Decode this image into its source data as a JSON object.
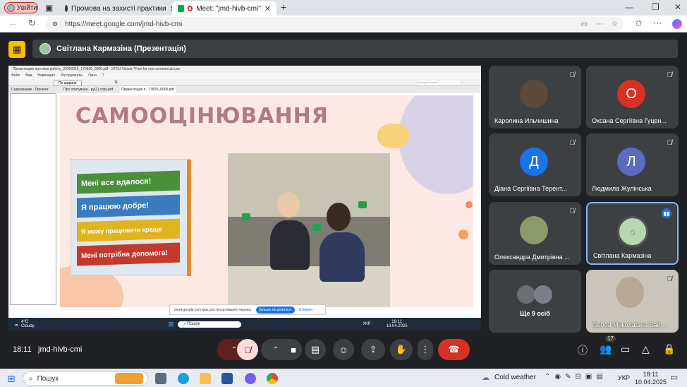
{
  "browser": {
    "profile_label": "Увійти",
    "tabs": [
      {
        "title": "Промова на захисті практики"
      },
      {
        "title": "Meet: \"jmd-hivb-cmi\""
      }
    ],
    "new_tab": "+",
    "url": "https://meet.google.com/jmd-hivb-cmi"
  },
  "meet": {
    "presenting_label": "Світлана Кармазіна (Презентація)",
    "shared_window": {
      "title": "Презентация про мою роботу_20250316_173826_0000.pdf - STDU Viewer *Free for non-commercial use",
      "menu": [
        "Файл",
        "Вид",
        "Навигация",
        "Инструменты",
        "Окно",
        "?"
      ],
      "zoom": "По ширине",
      "page": "11",
      "search_placeholder": "Быстрый поиск",
      "sidebar_tab": "Содержание - Презент",
      "doc_tabs": [
        "Про опитуванн...ру(1) copy.pdf",
        "Презентация п...73826_0000.pdf"
      ],
      "slide_title": "САМООЦІНЮВАННЯ",
      "lego_rows": [
        {
          "text": "Мені все вдалося!",
          "color": "#4a8f3a"
        },
        {
          "text": "Я працюю добре!",
          "color": "#3a7cc0"
        },
        {
          "text": "Я можу працювати краще",
          "color": "#e0b420"
        },
        {
          "text": "Мені потрібна допомога!",
          "color": "#c23a2c"
        }
      ],
      "notification": {
        "text": "meet.google.com має доступ до вашого екрана.",
        "stop_button": "Більше не ділитися",
        "hide_link": "Сховати"
      },
      "taskbar": {
        "weather_temp": "4°C",
        "weather_desc": "Cloudy",
        "search_label": "Пошук",
        "lang": "УКР",
        "time": "18:11",
        "date": "10.04.2025"
      }
    },
    "participants": [
      {
        "name": "Каролина Ильчишина",
        "initial": "",
        "avatar_color": "#5c4a3c",
        "muted": true,
        "speaking": false
      },
      {
        "name": "Оксана Сергіївна Гуцен...",
        "initial": "О",
        "avatar_color": "#d93025",
        "muted": true,
        "speaking": false
      },
      {
        "name": "Діана Сергіївна Терент...",
        "initial": "Д",
        "avatar_color": "#1a73e8",
        "muted": true,
        "speaking": false
      },
      {
        "name": "Людмила Жулінська",
        "initial": "Л",
        "avatar_color": "#5c6bc0",
        "muted": true,
        "speaking": false
      },
      {
        "name": "Олександра Дмитрівна ...",
        "initial": "",
        "avatar_color": "#8a9a6a",
        "muted": true,
        "speaking": false
      },
      {
        "name": "Світлана Кармазіна",
        "initial": "",
        "avatar_color": "#b8d7b0",
        "muted": false,
        "speaking": true
      },
      {
        "name": "Ще 9 осіб",
        "initial": "",
        "avatar_color": "#6a6f74",
        "muted": false,
        "speaking": false
      },
      {
        "name": "Любов Миколаївна Бай...",
        "initial": "",
        "avatar_color": "#c9c4bc",
        "muted": true,
        "speaking": false
      }
    ],
    "bottom": {
      "time": "18:11",
      "meeting_code": "jmd-hivb-cmi",
      "people_count": "17"
    }
  },
  "os_taskbar": {
    "search_label": "Пошук",
    "weather": "Cold weather",
    "lang": "УКР",
    "time": "18:11",
    "date": "10.04.2025"
  },
  "icons": [
    "tab-grid-icon",
    "chrome-icon",
    "camera-icon",
    "mic-off-icon",
    "present-icon",
    "hand-icon",
    "more-icon",
    "end-call-icon",
    "info-icon",
    "people-icon",
    "chat-icon",
    "activities-icon",
    "lock-icon",
    "windows-start-icon",
    "search-icon"
  ]
}
